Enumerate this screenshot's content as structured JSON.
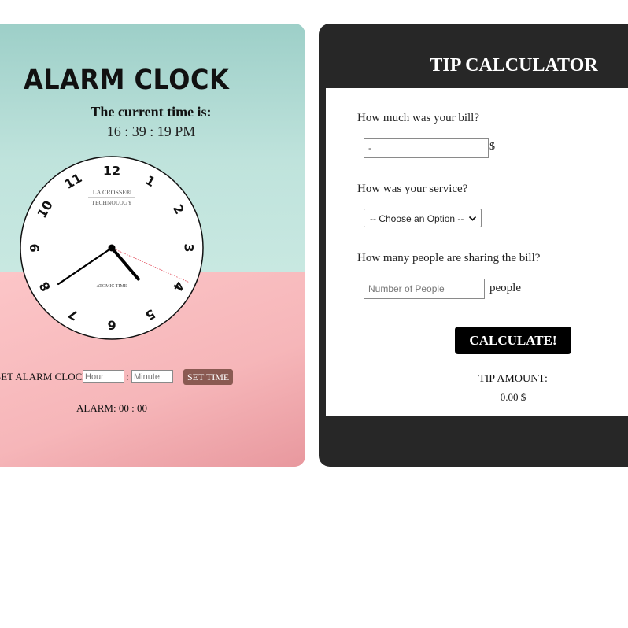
{
  "alarm_clock": {
    "title": "ALARM CLOCK",
    "current_label": "The current time is:",
    "current_time": "16 : 39 : 19 PM",
    "clock_face": {
      "brand_line1": "LA CROSSE®",
      "brand_line2": "TECHNOLOGY",
      "atomic_label": "ATOMIC TIME",
      "numerals": [
        "12",
        "1",
        "2",
        "3",
        "4",
        "5",
        "6",
        "7",
        "8",
        "9",
        "10",
        "11"
      ],
      "time": {
        "hour": 4,
        "minute": 39,
        "second": 19
      }
    },
    "set_alarm_label": "SET ALARM CLOCK:",
    "hour_placeholder": "Hour",
    "colon": ":",
    "minute_placeholder": "Minute",
    "set_time_label": "SET TIME",
    "alarm_display": "ALARM: 00 : 00",
    "colors": {
      "teal": "#c6e7e0",
      "pink": "#f7b5b8",
      "button": "#8a5a52"
    }
  },
  "tip_calculator": {
    "title": "TIP CALCULATOR",
    "bill_question": "How much was your bill?",
    "bill_value": "-",
    "bill_currency": "$",
    "service_question": "How was your service?",
    "service_selected": "-- Choose an Option --",
    "people_question": "How many people are sharing the bill?",
    "people_placeholder": "Number of People",
    "people_unit": "people",
    "calculate_label": "CALCULATE!",
    "tip_amount_label": "TIP AMOUNT:",
    "tip_amount_value": "0.00 $",
    "colors": {
      "panel": "#272727",
      "button": "#000000"
    }
  }
}
